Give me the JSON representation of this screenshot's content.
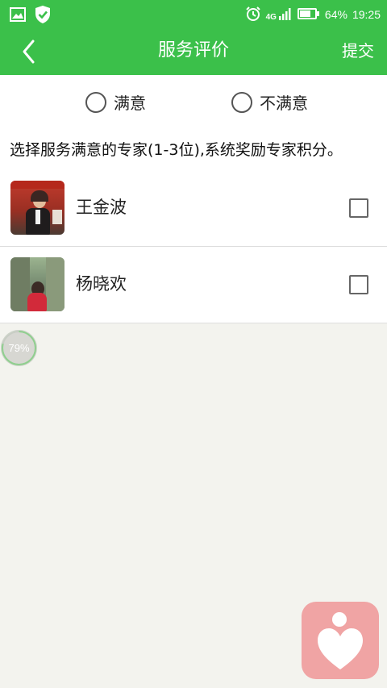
{
  "status_bar": {
    "network": "4G",
    "battery_percent": "64%",
    "time": "19:25",
    "icons": [
      "image-icon",
      "shield-check-icon",
      "alarm-icon",
      "signal-icon",
      "battery-icon"
    ]
  },
  "header": {
    "title": "服务评价",
    "submit_label": "提交",
    "back_icon": "chevron-left-icon",
    "bg_color": "#3bc04a"
  },
  "rating": {
    "options": [
      {
        "label": "满意",
        "selected": false
      },
      {
        "label": "不满意",
        "selected": false
      }
    ]
  },
  "hint": "选择服务满意的专家(1-3位),系统奖励专家积分。",
  "experts": [
    {
      "name": "王金波",
      "checked": false
    },
    {
      "name": "杨晓欢",
      "checked": false
    }
  ],
  "progress": {
    "label": "79%",
    "value": 0.79
  },
  "fab": {
    "icon": "heart-person-icon",
    "color": "#f0a4a4"
  }
}
